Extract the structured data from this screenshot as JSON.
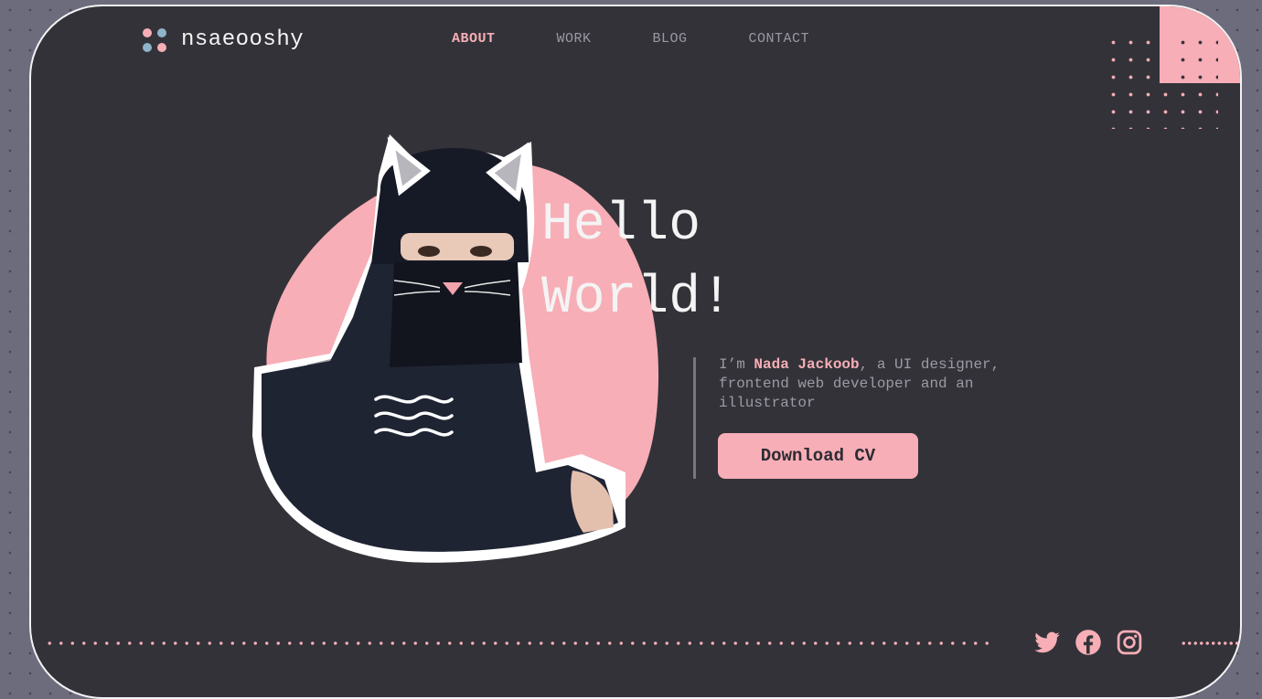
{
  "logo": {
    "text": "nsaeooshy",
    "dot_colors": [
      "#f7aeb6",
      "#8fb3c9",
      "#8fb3c9",
      "#f7aeb6"
    ]
  },
  "nav": [
    {
      "label": "ABOUT",
      "active": true
    },
    {
      "label": "WORK",
      "active": false
    },
    {
      "label": "BLOG",
      "active": false
    },
    {
      "label": "CONTACT",
      "active": false
    }
  ],
  "hero": {
    "line1": "Hello",
    "line2": "World!",
    "intro_prefix": "I’m ",
    "name": "Nada Jackoob",
    "intro_suffix": ", a UI designer, frontend web developer and an illustrator",
    "cta_label": "Download CV"
  },
  "socials": [
    {
      "icon": "twitter-icon"
    },
    {
      "icon": "facebook-icon"
    },
    {
      "icon": "instagram-icon"
    }
  ],
  "colors": {
    "accent": "#f7aeb6",
    "background": "#333239",
    "outer": "#6d6c7c",
    "text": "#f4f4f4",
    "muted": "#9c9aa5"
  }
}
